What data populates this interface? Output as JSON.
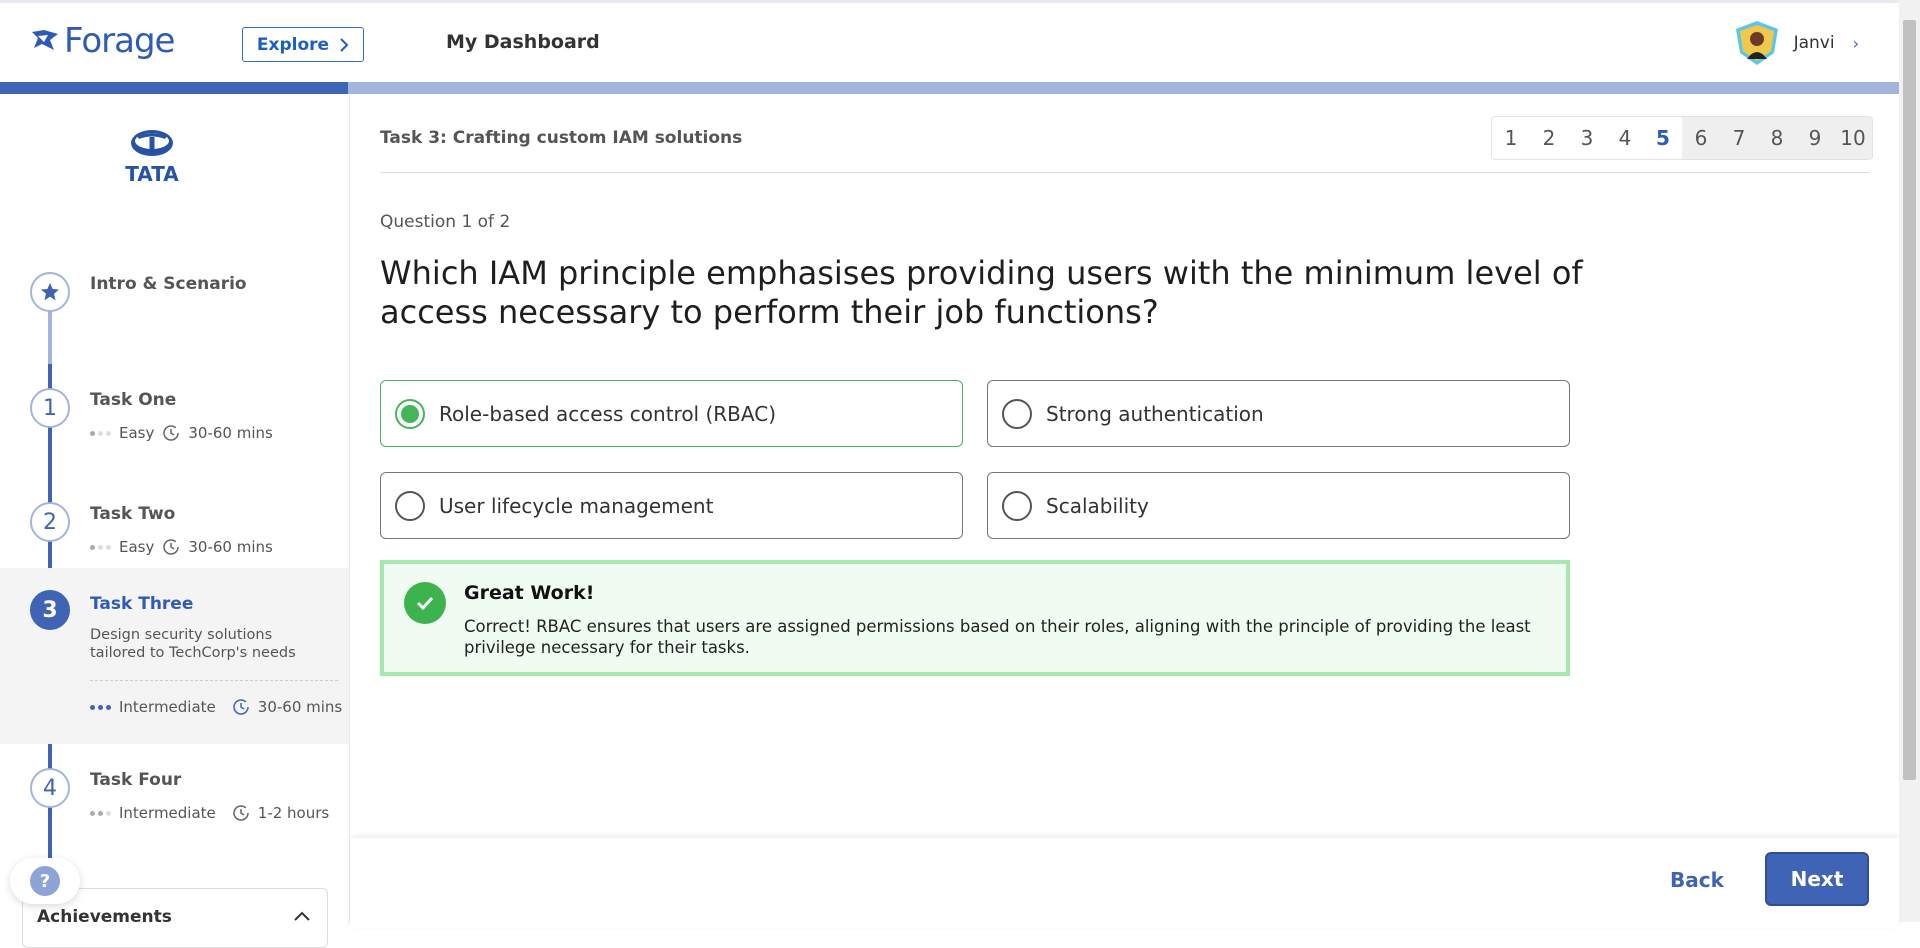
{
  "header": {
    "logo_text": "Forage",
    "explore_label": "Explore",
    "dashboard_label": "My Dashboard",
    "user_name": "Janvi"
  },
  "progress": {
    "fraction": 0.183
  },
  "sidebar": {
    "brand": "TATA",
    "steps": [
      {
        "marker": "star",
        "title": "Intro & Scenario"
      },
      {
        "marker": "1",
        "title": "Task One",
        "difficulty": "Easy",
        "duration": "30-60 mins"
      },
      {
        "marker": "2",
        "title": "Task Two",
        "difficulty": "Easy",
        "duration": "30-60 mins"
      },
      {
        "marker": "3",
        "title": "Task Three",
        "description": "Design security solutions tailored to TechCorp's needs",
        "difficulty": "Intermediate",
        "duration": "30-60 mins",
        "active": true
      },
      {
        "marker": "4",
        "title": "Task Four",
        "difficulty": "Intermediate",
        "duration": "1-2 hours"
      }
    ],
    "help_label": "?",
    "achievements_label": "Achievements"
  },
  "main": {
    "task_heading": "Task 3: Crafting custom IAM solutions",
    "pages": [
      "1",
      "2",
      "3",
      "4",
      "5",
      "6",
      "7",
      "8",
      "9",
      "10"
    ],
    "current_page": "5",
    "question_count": "Question 1 of 2",
    "question": "Which IAM principle emphasises providing users with the minimum level of access necessary to perform their job functions?",
    "options": [
      {
        "label": "Role-based access control (RBAC)",
        "selected": true
      },
      {
        "label": "Strong authentication",
        "selected": false
      },
      {
        "label": "User lifecycle management",
        "selected": false
      },
      {
        "label": "Scalability",
        "selected": false
      }
    ],
    "feedback": {
      "title": "Great Work!",
      "text": "Correct! RBAC ensures that users are assigned permissions based on their roles, aligning with the principle of providing the least privilege necessary for their tasks."
    },
    "back_label": "Back",
    "next_label": "Next"
  },
  "colors": {
    "brand_blue": "#3f64b5",
    "progress_track": "#a3b5da",
    "success_green": "#45b55a",
    "feedback_bg": "#f0fbf1"
  }
}
